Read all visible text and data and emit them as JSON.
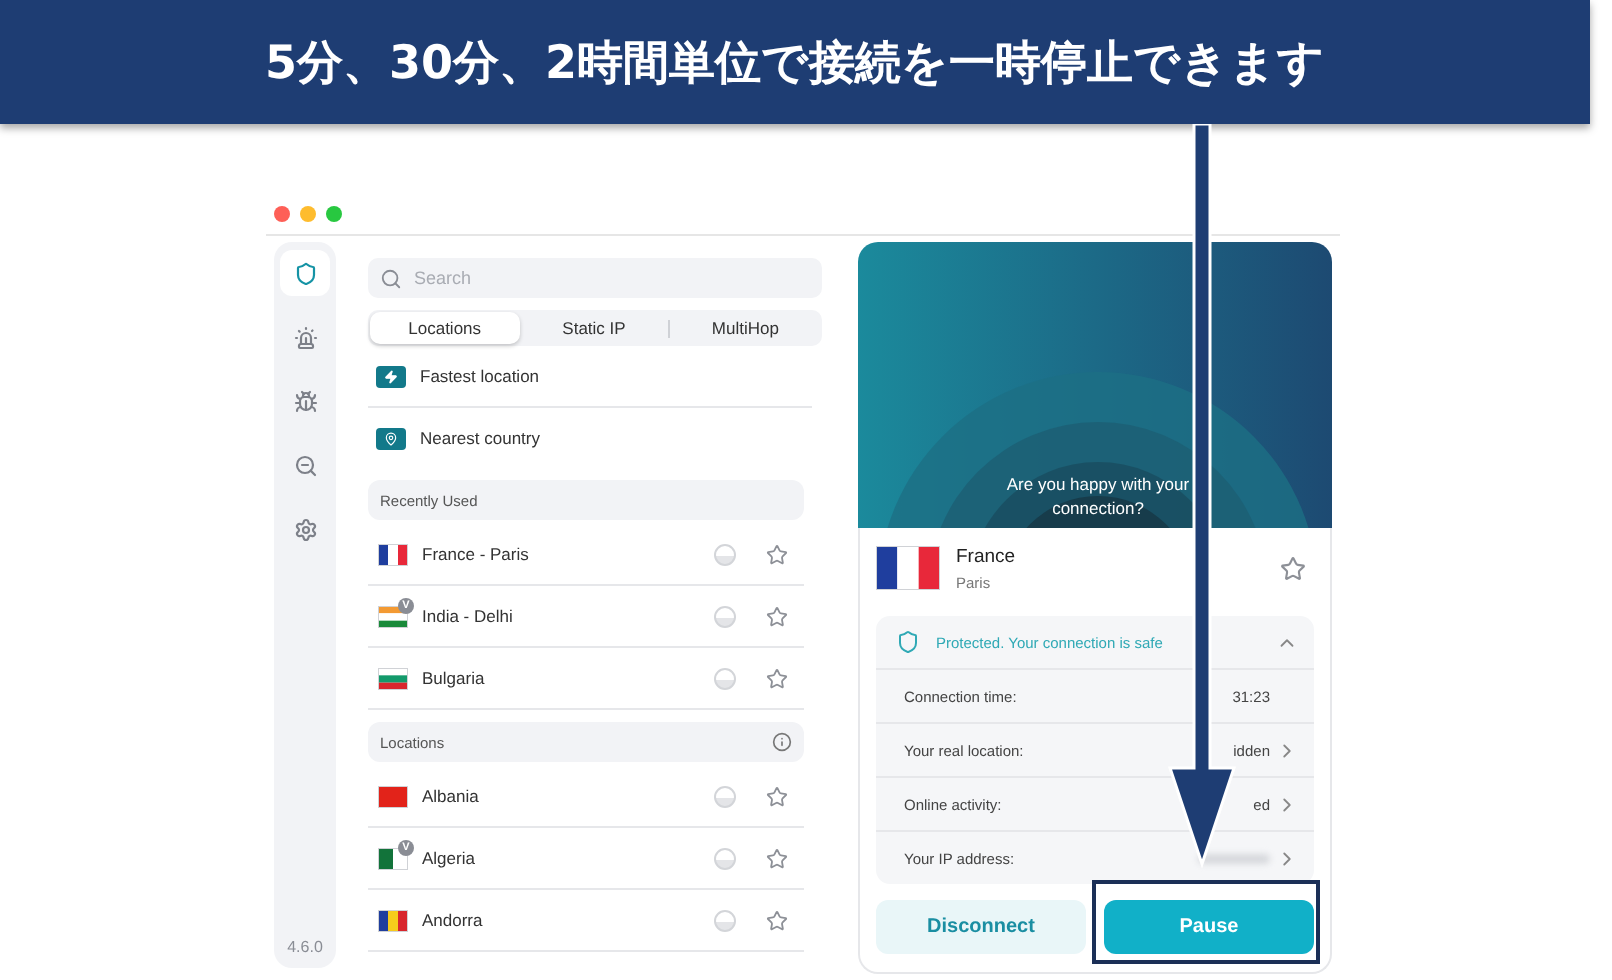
{
  "banner": {
    "text": "5分、30分、2時間単位で接続を一時停止できます"
  },
  "sidebar": {
    "items": [
      {
        "selected": true
      },
      {
        "selected": false
      },
      {
        "selected": false
      },
      {
        "selected": false
      },
      {
        "selected": false
      }
    ],
    "version": "4.6.0"
  },
  "search": {
    "placeholder": "Search"
  },
  "tabs": [
    {
      "label": "Locations",
      "selected": true
    },
    {
      "label": "Static IP",
      "selected": false
    },
    {
      "label": "MultiHop",
      "selected": false
    }
  ],
  "quick_items": [
    {
      "label": "Fastest location"
    },
    {
      "label": "Nearest country"
    }
  ],
  "sections": [
    {
      "title": "Recently Used",
      "info": false,
      "rows": [
        {
          "name": "France - Paris",
          "kind": "france"
        },
        {
          "name": "India - Delhi",
          "kind": "india",
          "badge": "V"
        },
        {
          "name": "Bulgaria",
          "kind": "bulgaria"
        }
      ]
    },
    {
      "title": "Locations",
      "info": true,
      "rows": [
        {
          "name": "Albania",
          "kind": "albania"
        },
        {
          "name": "Algeria",
          "kind": "algeria",
          "badge": "V"
        },
        {
          "name": "Andorra",
          "kind": "andorra"
        }
      ]
    }
  ],
  "hero": {
    "question": "Are you happy with your connection?"
  },
  "connection": {
    "country": "France",
    "city": "Paris",
    "kind": "france"
  },
  "status": {
    "text": "Protected. Your connection is safe",
    "expanded": true,
    "rows": [
      {
        "label": "Connection time:",
        "value": "31:23",
        "kind": "plain"
      },
      {
        "label": "Your real location:",
        "value": "idden",
        "kind": "link"
      },
      {
        "label": "Online activity:",
        "value": "ed",
        "kind": "link"
      },
      {
        "label": "Your IP address:",
        "kind": "blurred"
      }
    ]
  },
  "buttons": [
    {
      "label": "Disconnect",
      "kind": "secondary"
    },
    {
      "label": "Pause",
      "kind": "primary",
      "highlighted": true
    }
  ]
}
